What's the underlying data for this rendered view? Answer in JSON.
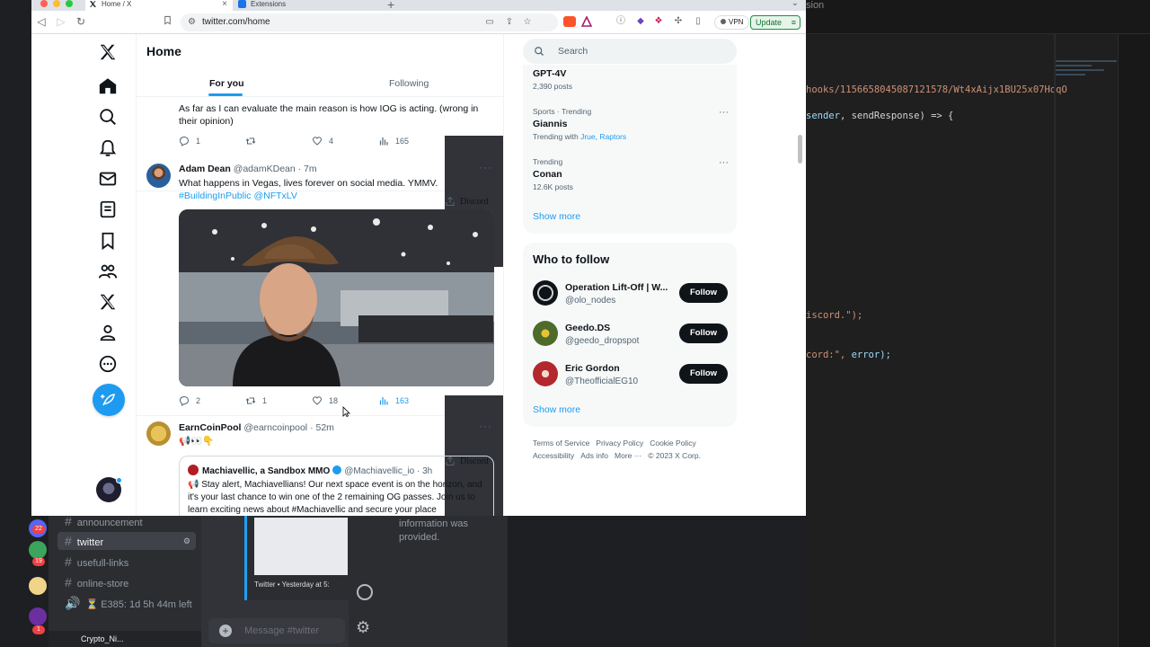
{
  "browser": {
    "tabs": [
      {
        "label": "Home / X",
        "active": true
      },
      {
        "label": "Extensions",
        "active": false
      }
    ],
    "url": "twitter.com/home",
    "vpn_label": "VPN",
    "update_label": "Update"
  },
  "twitter": {
    "header": {
      "title": "Home"
    },
    "tabs": [
      {
        "label": "For you",
        "active": true
      },
      {
        "label": "Following",
        "active": false
      }
    ],
    "tweets": [
      {
        "text": "As far as I can evaluate the main reason is how IOG is acting. (wrong in their opinion)",
        "replies": "1",
        "retweets": "",
        "likes": "4",
        "views": "165",
        "discord_label": "Discord"
      },
      {
        "name": "Adam Dean",
        "handle": "@adamKDean",
        "time": "· 7m",
        "text": "What happens in Vegas, lives forever on social media. YMMV.",
        "hashtag": "#BuildingInPublic",
        "mention": "@NFTxLV",
        "replies": "2",
        "retweets": "1",
        "likes": "18",
        "views": "163",
        "discord_label": "Discord"
      },
      {
        "name": "EarnCoinPool",
        "handle": "@earncoinpool",
        "time": "· 52m",
        "text": "📢👀👇",
        "quote": {
          "name": "Machiavellic, a Sandbox MMO",
          "handle": "@Machiavellic_io",
          "time": "· 3h",
          "text": "📢 Stay alert, Machiavellians! Our next space event is on the horizon, and it's your last chance to win one of the 2 remaining OG passes. Join us to learn exciting news about #Machiavellic and secure your place"
        }
      }
    ],
    "search": {
      "placeholder": "Search"
    },
    "trends": [
      {
        "meta": "",
        "name": "GPT-4V",
        "sub": "2,390 posts"
      },
      {
        "meta": "Sports · Trending",
        "name": "Giannis",
        "sub_prefix": "Trending with",
        "sub_links": [
          "Jrue",
          "Raptors"
        ]
      },
      {
        "meta": "Trending",
        "name": "Conan",
        "sub": "12.6K posts"
      }
    ],
    "show_more": "Show more",
    "who_to_follow": {
      "title": "Who to follow",
      "accounts": [
        {
          "name": "Operation Lift-Off | W...",
          "handle": "@olo_nodes",
          "button": "Follow"
        },
        {
          "name": "Geedo.DS",
          "handle": "@geedo_dropspot",
          "button": "Follow"
        },
        {
          "name": "Eric Gordon",
          "handle": "@TheofficialEG10",
          "button": "Follow"
        }
      ],
      "show_more": "Show more"
    },
    "footer": {
      "links": [
        "Terms of Service",
        "Privacy Policy",
        "Cookie Policy",
        "Accessibility",
        "Ads info",
        "More ···"
      ],
      "copyright": "© 2023 X Corp."
    }
  },
  "discord": {
    "channels": [
      "announcement",
      "twitter",
      "usefull-links",
      "online-store"
    ],
    "active_channel": "twitter",
    "voice_status": "⏳ E385: 1d 5h 44m left",
    "embed_footer": "Twitter • Yesterday at 5:",
    "message_placeholder": "Message #twitter",
    "members_text": "information was provided.",
    "username": "Crypto_Ni...",
    "badges": [
      "22",
      "19",
      "1"
    ]
  },
  "editor": {
    "line1": "hooks/1156658045087121578/Wt4xAijx1BU25x07HoqO",
    "line2_a": "sender",
    "line2_b": ", sendResponse) => {",
    "line3": "iscord.\");",
    "line4_a": "cord:\",",
    "line4_b": " error);"
  }
}
